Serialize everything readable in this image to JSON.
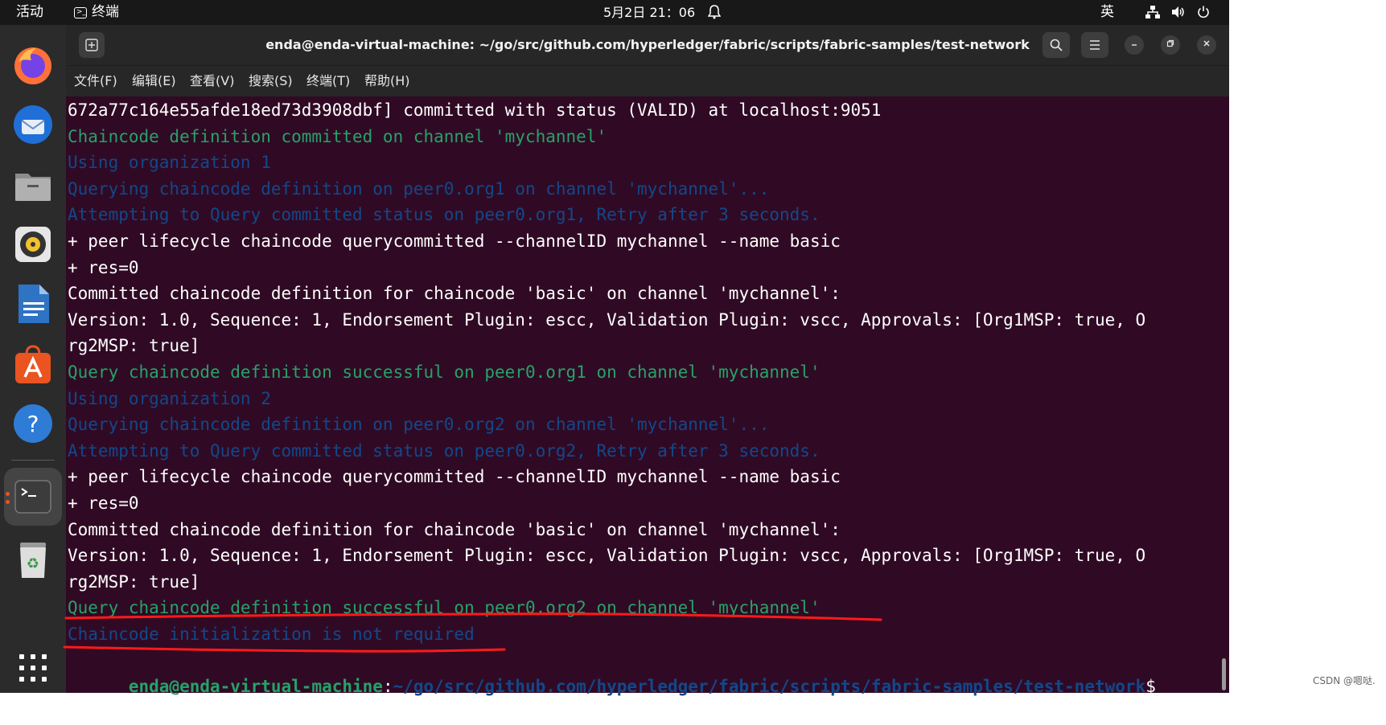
{
  "topbar": {
    "activities": "活动",
    "app_name": "终端",
    "clock": "5月2日  21：06",
    "input_method": "英"
  },
  "dock": {
    "items": [
      "firefox-icon",
      "thunderbird-icon",
      "files-icon",
      "rhythmbox-icon",
      "libreoffice-writer-icon",
      "app-center-icon",
      "help-icon",
      "terminal-icon",
      "trash-icon",
      "show-apps-icon"
    ]
  },
  "window": {
    "title": "enda@enda-virtual-machine: ~/go/src/github.com/hyperledger/fabric/scripts/fabric-samples/test-network",
    "menu": [
      "文件(F)",
      "编辑(E)",
      "查看(V)",
      "搜索(S)",
      "终端(T)",
      "帮助(H)"
    ]
  },
  "terminal": {
    "lines": [
      {
        "text": "672a77c164e55afde18ed73d3908dbf] committed with status (VALID) at localhost:9051",
        "color": "white"
      },
      {
        "text": "Chaincode definition committed on channel 'mychannel'",
        "color": "green"
      },
      {
        "text": "Using organization 1",
        "color": "blue"
      },
      {
        "text": "Querying chaincode definition on peer0.org1 on channel 'mychannel'...",
        "color": "blue"
      },
      {
        "text": "Attempting to Query committed status on peer0.org1, Retry after 3 seconds.",
        "color": "blue"
      },
      {
        "text": "+ peer lifecycle chaincode querycommitted --channelID mychannel --name basic",
        "color": "white"
      },
      {
        "text": "+ res=0",
        "color": "white"
      },
      {
        "text": "Committed chaincode definition for chaincode 'basic' on channel 'mychannel':",
        "color": "white"
      },
      {
        "text": "Version: 1.0, Sequence: 1, Endorsement Plugin: escc, Validation Plugin: vscc, Approvals: [Org1MSP: true, O",
        "color": "white"
      },
      {
        "text": "rg2MSP: true]",
        "color": "white"
      },
      {
        "text": "Query chaincode definition successful on peer0.org1 on channel 'mychannel'",
        "color": "green"
      },
      {
        "text": "Using organization 2",
        "color": "blue"
      },
      {
        "text": "Querying chaincode definition on peer0.org2 on channel 'mychannel'...",
        "color": "blue"
      },
      {
        "text": "Attempting to Query committed status on peer0.org2, Retry after 3 seconds.",
        "color": "blue"
      },
      {
        "text": "+ peer lifecycle chaincode querycommitted --channelID mychannel --name basic",
        "color": "white"
      },
      {
        "text": "+ res=0",
        "color": "white"
      },
      {
        "text": "Committed chaincode definition for chaincode 'basic' on channel 'mychannel':",
        "color": "white"
      },
      {
        "text": "Version: 1.0, Sequence: 1, Endorsement Plugin: escc, Validation Plugin: vscc, Approvals: [Org1MSP: true, O",
        "color": "white"
      },
      {
        "text": "rg2MSP: true]",
        "color": "white"
      },
      {
        "text": "Query chaincode definition successful on peer0.org2 on channel 'mychannel'",
        "color": "green"
      },
      {
        "text": "Chaincode initialization is not required",
        "color": "blue"
      }
    ],
    "prompt_user": "enda@enda-virtual-machine",
    "prompt_sep": ":",
    "prompt_path": "~/go/src/github.com/hyperledger/fabric/scripts/fabric-samples/test-network",
    "prompt_symbol": "$"
  },
  "colors": {
    "terminal_bg": "#300a24",
    "green": "#26a269",
    "blue": "#12488b",
    "annotation": "#ff1a1a"
  },
  "watermark": "CSDN @嗯哒."
}
